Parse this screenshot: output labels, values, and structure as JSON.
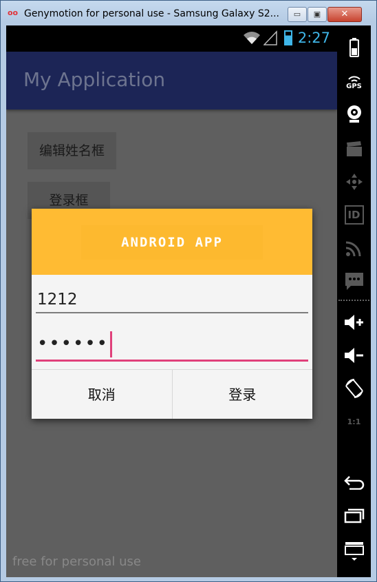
{
  "window": {
    "title": "Genymotion for personal use - Samsung Galaxy S2...",
    "minimize_label": "▭",
    "maximize_label": "▣",
    "close_label": "✕"
  },
  "statusbar": {
    "time": "2:27"
  },
  "app": {
    "title": "My Application",
    "edit_name_button": "编辑姓名框",
    "login_frame_button": "登录框"
  },
  "dialog": {
    "header_logo_text": "ANDROID APP",
    "username_value": "1212",
    "password_value": "••••••",
    "cancel_label": "取消",
    "login_label": "登录"
  },
  "watermark": "free for personal use",
  "sidebar": {
    "gps_label": "GPS",
    "id_label": "ID",
    "pixel_label": "1:1"
  },
  "colors": {
    "actionbar": "#1c2556",
    "dialog_header": "#ffbb33",
    "accent": "#e0407a",
    "status_blue": "#3fb6e8"
  }
}
